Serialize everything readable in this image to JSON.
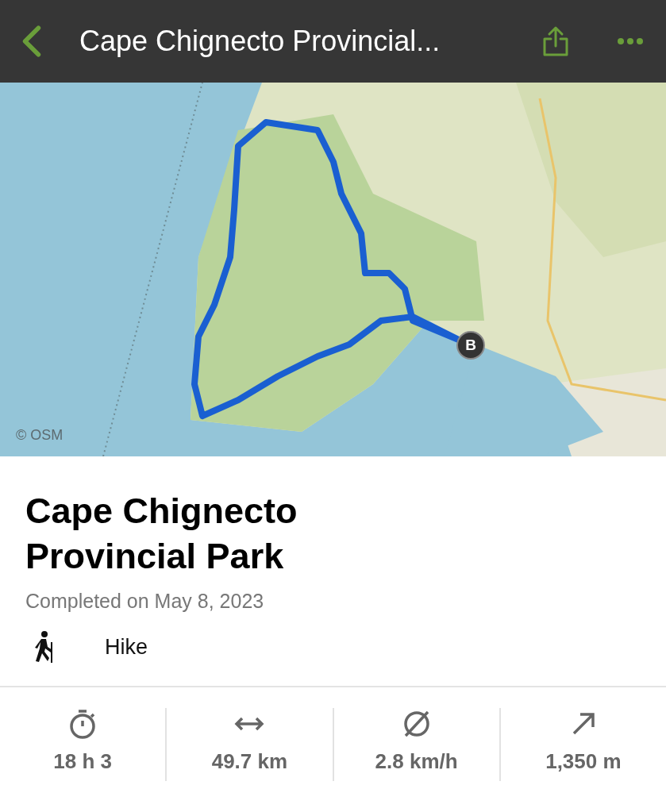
{
  "header": {
    "title": "Cape Chignecto Provincial..."
  },
  "map": {
    "attribution": "© OSM",
    "end_marker": "B"
  },
  "activity": {
    "title": "Cape Chignecto Provincial Park",
    "completed": "Completed on May 8, 2023",
    "type": "Hike"
  },
  "stats": [
    {
      "kind": "duration",
      "value": "18 h 3"
    },
    {
      "kind": "distance",
      "value": "49.7 km"
    },
    {
      "kind": "speed",
      "value": "2.8 km/h"
    },
    {
      "kind": "ascent",
      "value": "1,350 m"
    }
  ]
}
